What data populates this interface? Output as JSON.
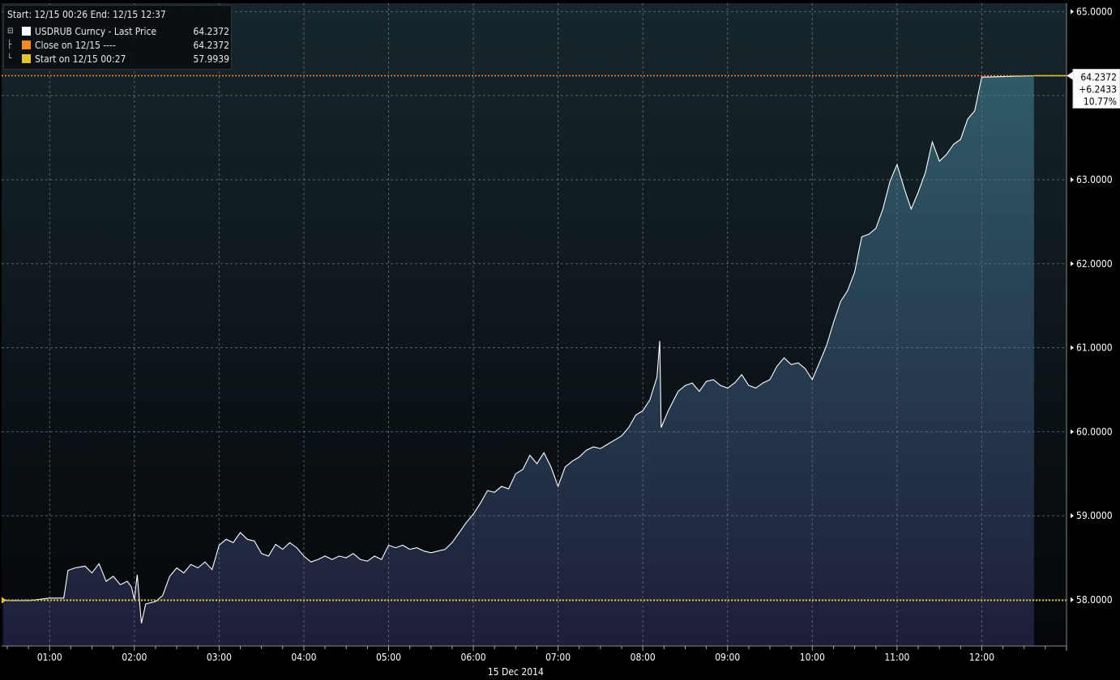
{
  "legend": {
    "header": "Start: 12/15 00:26 End: 12/15 12:37",
    "rows": [
      {
        "label": "USDRUB Curncy - Last Price",
        "value": "64.2372",
        "color": "#ffffff"
      },
      {
        "label": "Close on 12/15 ----",
        "value": "64.2372",
        "color": "#f28c1e"
      },
      {
        "label": "Start on 12/15 00:27",
        "value": "57.9939",
        "color": "#e5c42c"
      }
    ]
  },
  "last_label": {
    "price": "64.2372",
    "change": "+6.2433",
    "pct": "10.77%"
  },
  "colors": {
    "background_top": "#17262d",
    "background_bottom": "#04070a",
    "area_top": "#2f5a66",
    "area_bottom": "#1d1e38",
    "line": "#ffffff",
    "close_line": "#f28c1e",
    "start_line": "#e5c42c",
    "grid": "#6b7378"
  },
  "chart_data": {
    "type": "area",
    "title": "",
    "series_name": "USDRUB Curncy - Last Price",
    "xlabel": "15 Dec 2014",
    "x_ticks": [
      "01:00",
      "02:00",
      "03:00",
      "04:00",
      "05:00",
      "06:00",
      "07:00",
      "08:00",
      "09:00",
      "10:00",
      "11:00",
      "12:00"
    ],
    "y_ticks": [
      "65.0000",
      "63.0000",
      "62.0000",
      "61.0000",
      "60.0000",
      "59.0000",
      "58.0000"
    ],
    "y_tick_values": [
      65,
      63,
      62,
      61,
      60,
      59,
      58
    ],
    "xlim": [
      "00:26",
      "13:00"
    ],
    "ylim": [
      57.45,
      65.1
    ],
    "reference_lines": [
      {
        "name": "Close on 12/15",
        "value": 64.2372,
        "style": "dotted"
      },
      {
        "name": "Start on 12/15 00:27",
        "value": 57.9939,
        "style": "dotted"
      }
    ],
    "points": [
      [
        "00:27",
        57.99
      ],
      [
        "00:45",
        57.99
      ],
      [
        "01:00",
        58.02
      ],
      [
        "01:10",
        58.02
      ],
      [
        "01:13",
        58.35
      ],
      [
        "01:18",
        58.38
      ],
      [
        "01:25",
        58.4
      ],
      [
        "01:30",
        58.32
      ],
      [
        "01:35",
        58.43
      ],
      [
        "01:40",
        58.22
      ],
      [
        "01:45",
        58.28
      ],
      [
        "01:50",
        58.18
      ],
      [
        "01:55",
        58.22
      ],
      [
        "01:58",
        58.15
      ],
      [
        "02:00",
        58.0
      ],
      [
        "02:02",
        58.3
      ],
      [
        "02:05",
        57.72
      ],
      [
        "02:08",
        57.95
      ],
      [
        "02:15",
        57.98
      ],
      [
        "02:20",
        58.05
      ],
      [
        "02:25",
        58.28
      ],
      [
        "02:30",
        58.38
      ],
      [
        "02:35",
        58.32
      ],
      [
        "02:40",
        58.42
      ],
      [
        "02:45",
        58.38
      ],
      [
        "02:50",
        58.45
      ],
      [
        "02:55",
        58.36
      ],
      [
        "03:00",
        58.65
      ],
      [
        "03:05",
        58.72
      ],
      [
        "03:10",
        58.68
      ],
      [
        "03:15",
        58.8
      ],
      [
        "03:20",
        58.72
      ],
      [
        "03:25",
        58.7
      ],
      [
        "03:30",
        58.55
      ],
      [
        "03:35",
        58.52
      ],
      [
        "03:40",
        58.66
      ],
      [
        "03:45",
        58.6
      ],
      [
        "03:50",
        58.68
      ],
      [
        "03:55",
        58.62
      ],
      [
        "04:00",
        58.52
      ],
      [
        "04:05",
        58.45
      ],
      [
        "04:10",
        58.48
      ],
      [
        "04:15",
        58.52
      ],
      [
        "04:20",
        58.48
      ],
      [
        "04:25",
        58.52
      ],
      [
        "04:30",
        58.5
      ],
      [
        "04:35",
        58.55
      ],
      [
        "04:40",
        58.48
      ],
      [
        "04:45",
        58.46
      ],
      [
        "04:50",
        58.52
      ],
      [
        "04:55",
        58.48
      ],
      [
        "05:00",
        58.65
      ],
      [
        "05:05",
        58.62
      ],
      [
        "05:10",
        58.65
      ],
      [
        "05:15",
        58.6
      ],
      [
        "05:20",
        58.62
      ],
      [
        "05:25",
        58.58
      ],
      [
        "05:30",
        58.56
      ],
      [
        "05:35",
        58.58
      ],
      [
        "05:40",
        58.6
      ],
      [
        "05:45",
        58.68
      ],
      [
        "05:50",
        58.8
      ],
      [
        "05:55",
        58.92
      ],
      [
        "06:00",
        59.02
      ],
      [
        "06:05",
        59.15
      ],
      [
        "06:10",
        59.3
      ],
      [
        "06:15",
        59.28
      ],
      [
        "06:20",
        59.35
      ],
      [
        "06:25",
        59.32
      ],
      [
        "06:30",
        59.5
      ],
      [
        "06:35",
        59.55
      ],
      [
        "06:40",
        59.72
      ],
      [
        "06:45",
        59.62
      ],
      [
        "06:50",
        59.75
      ],
      [
        "06:55",
        59.58
      ],
      [
        "07:00",
        59.35
      ],
      [
        "07:05",
        59.58
      ],
      [
        "07:10",
        59.65
      ],
      [
        "07:15",
        59.7
      ],
      [
        "07:20",
        59.78
      ],
      [
        "07:25",
        59.82
      ],
      [
        "07:30",
        59.8
      ],
      [
        "07:35",
        59.85
      ],
      [
        "07:40",
        59.9
      ],
      [
        "07:45",
        59.95
      ],
      [
        "07:50",
        60.05
      ],
      [
        "07:55",
        60.2
      ],
      [
        "08:00",
        60.25
      ],
      [
        "08:05",
        60.38
      ],
      [
        "08:10",
        60.65
      ],
      [
        "08:12",
        61.08
      ],
      [
        "08:13",
        60.05
      ],
      [
        "08:18",
        60.25
      ],
      [
        "08:25",
        60.48
      ],
      [
        "08:30",
        60.55
      ],
      [
        "08:35",
        60.58
      ],
      [
        "08:40",
        60.48
      ],
      [
        "08:45",
        60.6
      ],
      [
        "08:50",
        60.62
      ],
      [
        "08:55",
        60.55
      ],
      [
        "09:00",
        60.52
      ],
      [
        "09:05",
        60.58
      ],
      [
        "09:10",
        60.68
      ],
      [
        "09:15",
        60.55
      ],
      [
        "09:20",
        60.52
      ],
      [
        "09:25",
        60.58
      ],
      [
        "09:30",
        60.62
      ],
      [
        "09:35",
        60.78
      ],
      [
        "09:40",
        60.88
      ],
      [
        "09:45",
        60.8
      ],
      [
        "09:50",
        60.82
      ],
      [
        "09:55",
        60.75
      ],
      [
        "10:00",
        60.62
      ],
      [
        "10:05",
        60.82
      ],
      [
        "10:10",
        61.02
      ],
      [
        "10:15",
        61.3
      ],
      [
        "10:20",
        61.55
      ],
      [
        "10:25",
        61.68
      ],
      [
        "10:30",
        61.9
      ],
      [
        "10:35",
        62.32
      ],
      [
        "10:40",
        62.35
      ],
      [
        "10:45",
        62.42
      ],
      [
        "10:50",
        62.65
      ],
      [
        "10:55",
        62.98
      ],
      [
        "11:00",
        63.18
      ],
      [
        "11:05",
        62.9
      ],
      [
        "11:10",
        62.65
      ],
      [
        "11:15",
        62.85
      ],
      [
        "11:20",
        63.08
      ],
      [
        "11:25",
        63.45
      ],
      [
        "11:30",
        63.22
      ],
      [
        "11:35",
        63.3
      ],
      [
        "11:40",
        63.42
      ],
      [
        "11:45",
        63.48
      ],
      [
        "11:50",
        63.72
      ],
      [
        "11:55",
        63.82
      ],
      [
        "12:00",
        64.22
      ],
      [
        "12:37",
        64.2372
      ]
    ]
  }
}
